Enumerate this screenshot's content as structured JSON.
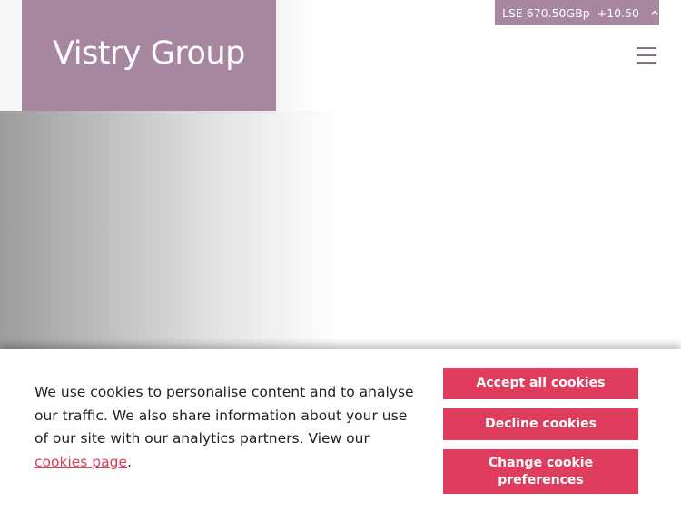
{
  "brand": {
    "logo_text": "Vistry Group",
    "brand_color": "#a7879f"
  },
  "ticker": {
    "label": "LSE 670.50GBp",
    "change": "+10.50",
    "icon": "chevron-up-icon"
  },
  "menu": {
    "icon": "hamburger-menu-icon"
  },
  "cookie_banner": {
    "text_before_link": "We use cookies to personalise content and to analyse our traffic. We also share information about your use of our site with our analytics partners. View our ",
    "link_text": "cookies page",
    "text_after_link": ".",
    "buttons": {
      "accept": "Accept all cookies",
      "decline": "Decline cookies",
      "change": "Change cookie preferences"
    },
    "button_color": "#de3d5d",
    "link_color": "#d93d5c"
  }
}
